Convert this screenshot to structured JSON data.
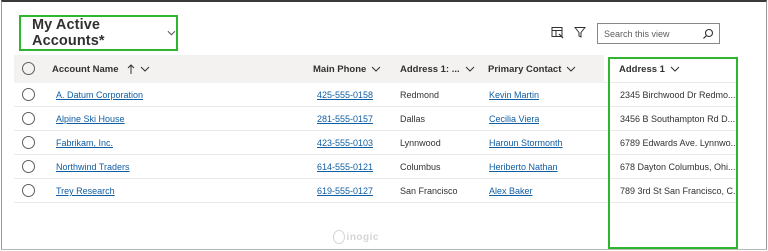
{
  "view": {
    "title": "My Active Accounts*"
  },
  "search": {
    "placeholder": "Search this view"
  },
  "columns": [
    {
      "label": "Account Name",
      "sort": "ascending"
    },
    {
      "label": "Main Phone"
    },
    {
      "label": "Address 1: ..."
    },
    {
      "label": "Primary Contact"
    },
    {
      "label": "Address 1"
    }
  ],
  "rows": [
    {
      "account": "A. Datum Corporation",
      "phone": "425-555-0158",
      "city": "Redmond",
      "contact": "Kevin Martin",
      "address": "2345 Birchwood Dr Redmo..."
    },
    {
      "account": "Alpine Ski House",
      "phone": "281-555-0157",
      "city": "Dallas",
      "contact": "Cecilia Viera",
      "address": "3456 B Southampton Rd D..."
    },
    {
      "account": "Fabrikam, Inc.",
      "phone": "423-555-0103",
      "city": "Lynnwood",
      "contact": "Haroun Stormonth",
      "address": "6789 Edwards Ave. Lynnwo..."
    },
    {
      "account": "Northwind Traders",
      "phone": "614-555-0121",
      "city": "Columbus",
      "contact": "Heriberto Nathan",
      "address": "678 Dayton Columbus, Ohi..."
    },
    {
      "account": "Trey Research",
      "phone": "619-555-0127",
      "city": "San Francisco",
      "contact": "Alex Baker",
      "address": "789 3rd St San Francisco, C..."
    }
  ],
  "watermark": {
    "text": "inogic"
  },
  "colors": {
    "link": "#115ea3",
    "highlight": "#2fb52f",
    "header_bg": "#f3f2f1"
  },
  "icons": [
    "chevron-down-icon",
    "edit-columns-icon",
    "filter-icon",
    "search-icon",
    "sort-ascending-icon",
    "radio-icon"
  ]
}
